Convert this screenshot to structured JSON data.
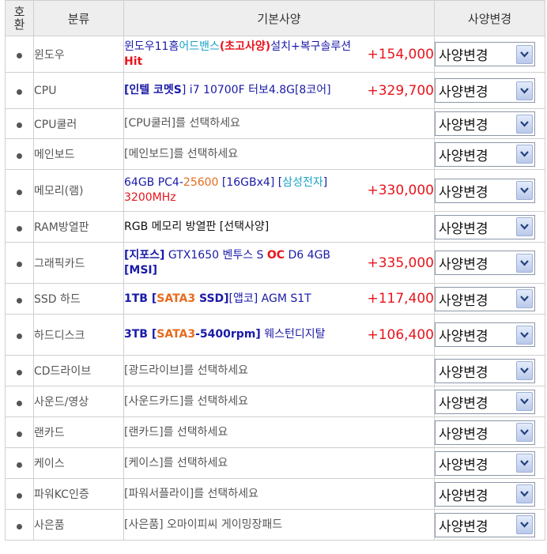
{
  "colors": {
    "default": "#333333",
    "blue": "#1a1aa8",
    "red": "#e8141b",
    "orange": "#e66c1f",
    "cyan": "#1aa3c4",
    "gray": "#555555",
    "black": "#111111"
  },
  "header": {
    "no_line1": "호",
    "no_line2": "환",
    "category": "분류",
    "spec": "기본사양",
    "change": "사양변경"
  },
  "rows": [
    {
      "category": "윈도우",
      "desc": [
        {
          "text": "윈도우11홈",
          "color": "#1a1aa8",
          "bold": false
        },
        {
          "text": "어드밴스",
          "color": "#1aa3c4",
          "bold": false
        },
        {
          "text": "(초고사양)",
          "color": "#e8141b",
          "bold": true
        },
        {
          "text": "설치+복구솔루션",
          "color": "#1a1aa8",
          "bold": false
        },
        {
          "text": "Hit",
          "color": "#e8141b",
          "bold": true
        }
      ],
      "price": "+154,000",
      "option": "사양변경"
    },
    {
      "category": "CPU",
      "desc": [
        {
          "text": "[인텔 코멧",
          "color": "#1a1aa8",
          "bold": true
        },
        {
          "text": "S",
          "color": "#1a1aa8",
          "bold": true
        },
        {
          "text": "] i7 10700F 터보4.8G[8코어]",
          "color": "#1a1aa8",
          "bold": false
        }
      ],
      "price": "+329,700",
      "option": "사양변경"
    },
    {
      "category": "CPU쿨러",
      "desc": [
        {
          "text": "[CPU쿨러]를 선택하세요",
          "color": "#555555",
          "bold": false
        }
      ],
      "price": "",
      "option": "사양변경"
    },
    {
      "category": "메인보드",
      "desc": [
        {
          "text": "[메인보드]를 선택하세요",
          "color": "#555555",
          "bold": false
        }
      ],
      "price": "",
      "option": "사양변경"
    },
    {
      "category": "메모리(램)",
      "desc": [
        {
          "text": "64GB PC4-",
          "color": "#1a1aa8",
          "bold": false
        },
        {
          "text": "25600",
          "color": "#e66c1f",
          "bold": false
        },
        {
          "text": " [16GBx4] [",
          "color": "#1a1aa8",
          "bold": false
        },
        {
          "text": "삼성전자",
          "color": "#1aa3c4",
          "bold": false
        },
        {
          "text": "] ",
          "color": "#1a1aa8",
          "bold": false
        },
        {
          "text": "3200MHz",
          "color": "#e8141b",
          "bold": false
        }
      ],
      "price": "+330,000",
      "option": "사양변경"
    },
    {
      "category": "RAM방열판",
      "desc": [
        {
          "text": "RGB 메모리 방열판 [선택사양]",
          "color": "#111111",
          "bold": false
        }
      ],
      "price": "",
      "option": "사양변경"
    },
    {
      "category": "그래픽카드",
      "desc": [
        {
          "text": "[지포스]",
          "color": "#1a1aa8",
          "bold": true
        },
        {
          "text": " GTX1650 벤투스 S ",
          "color": "#1a1aa8",
          "bold": false
        },
        {
          "text": "OC",
          "color": "#e8141b",
          "bold": true
        },
        {
          "text": " D6 4GB ",
          "color": "#1a1aa8",
          "bold": false
        },
        {
          "text": "[MSI]",
          "color": "#1a1aa8",
          "bold": true
        }
      ],
      "price": "+335,000",
      "option": "사양변경"
    },
    {
      "category": "SSD 하드",
      "desc": [
        {
          "text": "1TB [",
          "color": "#1a1aa8",
          "bold": true
        },
        {
          "text": "SATA3",
          "color": "#e66c1f",
          "bold": true
        },
        {
          "text": " SSD]",
          "color": "#1a1aa8",
          "bold": true
        },
        {
          "text": "[앱코] AGM S1T",
          "color": "#1a1aa8",
          "bold": false
        }
      ],
      "price": "+117,400",
      "option": "사양변경"
    },
    {
      "category": "하드디스크",
      "desc": [
        {
          "text": "3TB [",
          "color": "#1a1aa8",
          "bold": true
        },
        {
          "text": "SATA3",
          "color": "#e66c1f",
          "bold": true
        },
        {
          "text": "-5400rpm]",
          "color": "#1a1aa8",
          "bold": true
        },
        {
          "text": " 웨스턴디지탈",
          "color": "#1a1aa8",
          "bold": false
        }
      ],
      "price": "+106,400",
      "option": "사양변경"
    },
    {
      "category": "CD드라이브",
      "desc": [
        {
          "text": "[광드라이브]를 선택하세요",
          "color": "#555555",
          "bold": false
        }
      ],
      "price": "",
      "option": "사양변경"
    },
    {
      "category": "사운드/영상",
      "desc": [
        {
          "text": "[사운드카드]를 선택하세요",
          "color": "#555555",
          "bold": false
        }
      ],
      "price": "",
      "option": "사양변경"
    },
    {
      "category": "랜카드",
      "desc": [
        {
          "text": "[랜카드]를 선택하세요",
          "color": "#555555",
          "bold": false
        }
      ],
      "price": "",
      "option": "사양변경"
    },
    {
      "category": "케이스",
      "desc": [
        {
          "text": "[케이스]를 선택하세요",
          "color": "#555555",
          "bold": false
        }
      ],
      "price": "",
      "option": "사양변경"
    },
    {
      "category": "파워KC인증",
      "desc": [
        {
          "text": "[파워서플라이]를 선택하세요",
          "color": "#555555",
          "bold": false
        }
      ],
      "price": "",
      "option": "사양변경"
    },
    {
      "category": "사은품",
      "desc": [
        {
          "text": "[사은품] 오마이피씨 게이밍장패드",
          "color": "#555555",
          "bold": false
        }
      ],
      "price": "",
      "option": "사양변경"
    }
  ]
}
